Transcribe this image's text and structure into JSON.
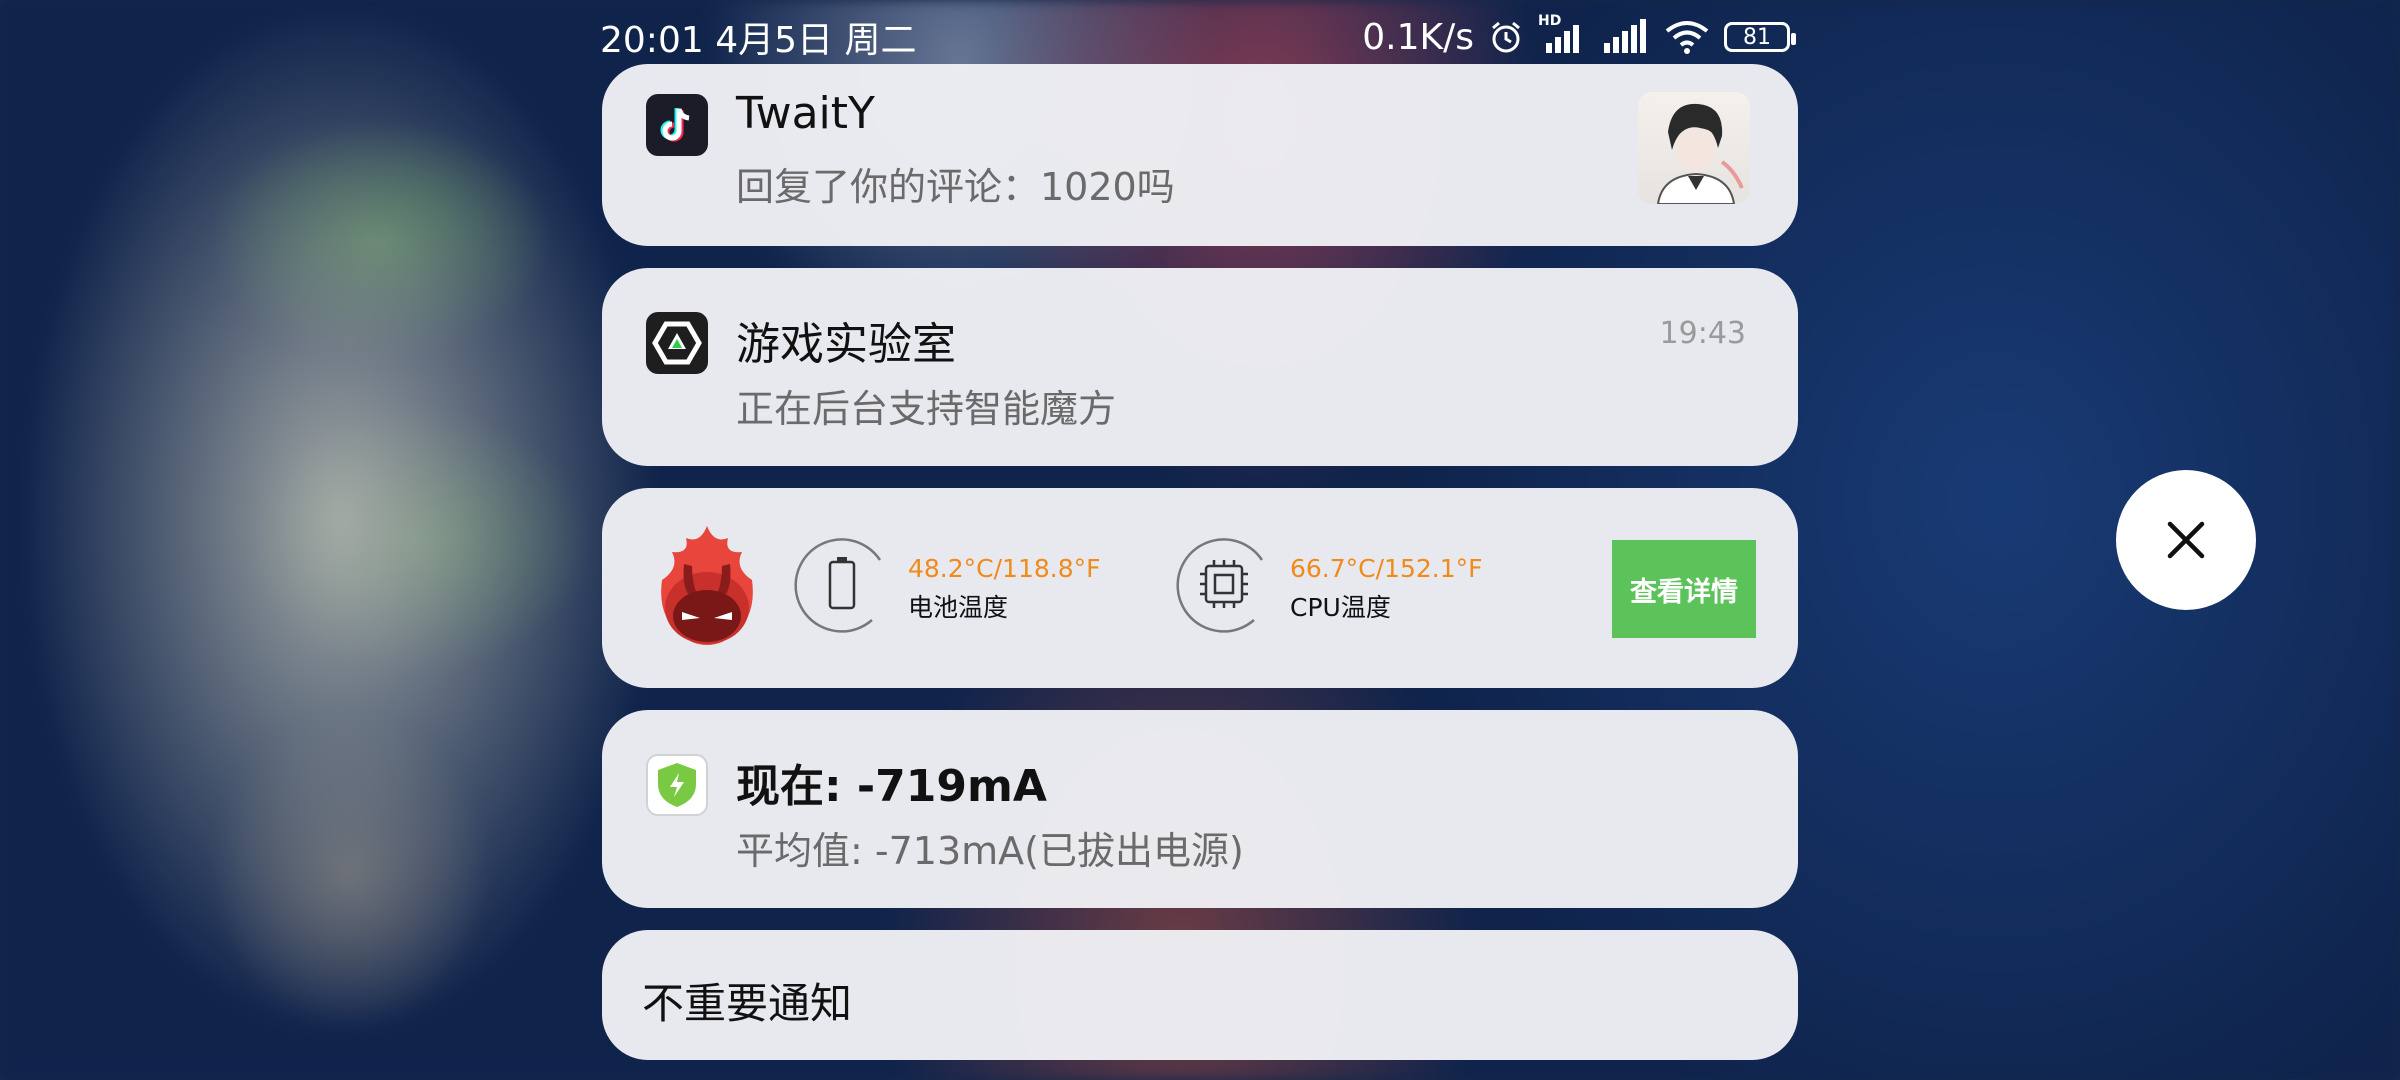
{
  "status_bar": {
    "datetime": "20:01 4月5日 周二",
    "net_speed": "0.1K/s",
    "hd_label": "HD",
    "battery": "81"
  },
  "notifications": [
    {
      "app": "tiktok",
      "title": "TwaitY",
      "body": "回复了你的评论：1020吗"
    },
    {
      "app": "game-lab",
      "title": "游戏实验室",
      "body": "正在后台支持智能魔方",
      "time": "19:43"
    },
    {
      "app": "antutu",
      "battery_temp": "48.2°C/118.8°F",
      "battery_label": "电池温度",
      "cpu_temp": "66.7°C/152.1°F",
      "cpu_label": "CPU温度",
      "button": "查看详情"
    },
    {
      "app": "battery-monitor",
      "title": "现在:   -719mA",
      "body": "平均值:  -713mA(已拔出电源)"
    }
  ],
  "unimportant": {
    "label": "不重要通知"
  },
  "colors": {
    "accent_green": "#5cc35a",
    "temp_orange": "#f08a1a",
    "card_bg": "#eef0f4"
  },
  "icons": [
    "tiktok-icon",
    "game-lab-icon",
    "antutu-icon",
    "battery-icon",
    "cpu-icon",
    "battery-shield-icon",
    "close-icon",
    "alarm-icon",
    "signal-icon",
    "wifi-icon"
  ]
}
